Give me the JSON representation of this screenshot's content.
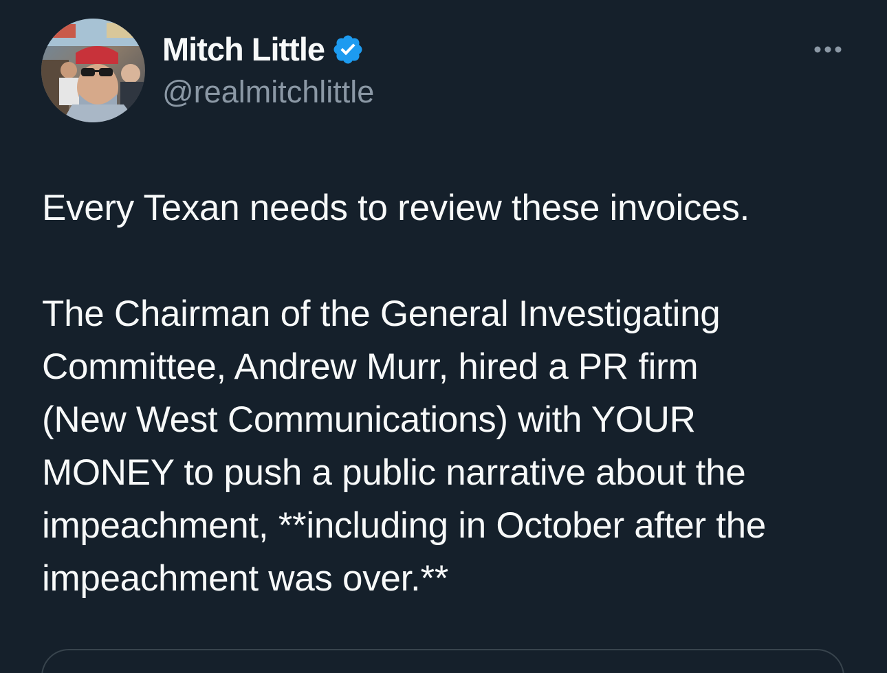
{
  "author": {
    "display_name": "Mitch Little",
    "handle": "@realmitchlittle",
    "verified_icon": "verified-badge-icon",
    "avatar_icon": "profile-photo"
  },
  "menu": {
    "more_icon": "ellipsis-icon"
  },
  "tweet": {
    "paragraph_1": "Every Texan needs to review these invoices.",
    "paragraph_2_lines": [
      "The Chairman of the General Investigating",
      "Committee, Andrew Murr, hired a PR firm",
      "(New West Communications) with YOUR",
      "MONEY to push a public narrative about the",
      "impeachment, **including in October after the",
      "impeachment was over.**"
    ]
  },
  "colors": {
    "background": "#15202b",
    "text_primary": "#f7f9f9",
    "text_secondary": "#8b98a5",
    "verified_blue": "#1d9bf0",
    "border": "#38444d"
  }
}
